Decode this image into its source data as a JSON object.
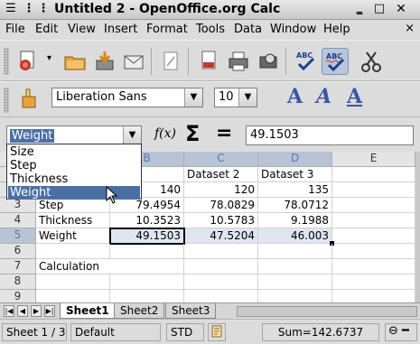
{
  "window": {
    "title": "Untitled 2 - OpenOffice.org Calc"
  },
  "menu": [
    "File",
    "Edit",
    "View",
    "Insert",
    "Format",
    "Tools",
    "Data",
    "Window",
    "Help"
  ],
  "menu_close": "×",
  "toolbar2": {
    "font_name": "Liberation Sans",
    "font_size": "10"
  },
  "formula_bar": {
    "name_box": "Weight",
    "value": "49.1503"
  },
  "name_dropdown": {
    "items": [
      "Size",
      "Step",
      "Thickness",
      "Weight"
    ],
    "highlighted": "Weight"
  },
  "grid": {
    "columns": [
      "B",
      "C",
      "D",
      "E"
    ],
    "rows": [
      "3",
      "4",
      "5",
      "6",
      "7",
      "8",
      "9"
    ],
    "top_row_partial": {
      "B": "et 1",
      "C": "Dataset 2",
      "D": "Dataset 3"
    },
    "row2": {
      "B": "140",
      "C": "120",
      "D": "135"
    },
    "row3": {
      "A": "Step",
      "B": "79.4954",
      "C": "78.0829",
      "D": "78.0712"
    },
    "row4": {
      "A": "Thickness",
      "B": "10.3523",
      "C": "10.5783",
      "D": "9.1988"
    },
    "row5": {
      "A": "Weight",
      "B": "49.1503",
      "C": "47.5204",
      "D": "46.003"
    },
    "row7": {
      "A": "Calculation"
    }
  },
  "sheet_tabs": [
    "Sheet1",
    "Sheet2",
    "Sheet3"
  ],
  "status": {
    "sheet": "Sheet 1 / 3",
    "page_style": "Default",
    "mode": "STD",
    "sum": "Sum=142.6737"
  },
  "colors": {
    "accent": "#4a6fa5",
    "selection": "#dfe6f1"
  }
}
